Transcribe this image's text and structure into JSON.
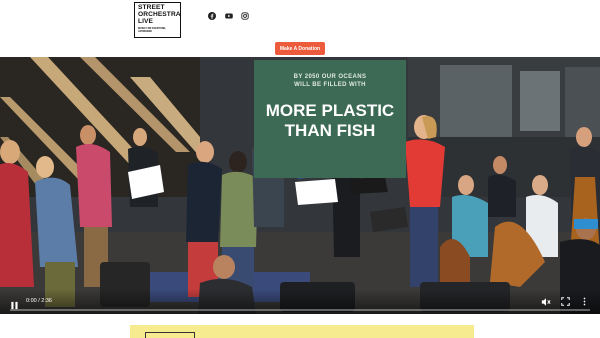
{
  "header": {
    "logo": {
      "lines": [
        "STREET",
        "ORCHESTRA",
        "LIVE"
      ],
      "tagline": "MUSIC FOR EVERYONE, ANYWHERE"
    },
    "social": [
      {
        "name": "facebook-icon"
      },
      {
        "name": "youtube-icon"
      },
      {
        "name": "instagram-icon"
      }
    ],
    "donate_label": "Make A Donation"
  },
  "video": {
    "banner": {
      "small_line1": "BY 2050 OUR OCEANS",
      "small_line2": "WILL BE FILLED WITH",
      "big_line1": "MORE PLASTIC",
      "big_line2": "THAN FISH"
    },
    "time_display": "0:00 / 2:36",
    "progress": 0.0,
    "colors": {
      "accent": "#ec5b3c",
      "banner": "#3d6a54",
      "next_section": "#f6eb8e"
    },
    "controls": {
      "play": "play-icon",
      "mute": "volume-muted-icon",
      "fullscreen": "fullscreen-icon",
      "more": "more-vertical-icon"
    }
  }
}
